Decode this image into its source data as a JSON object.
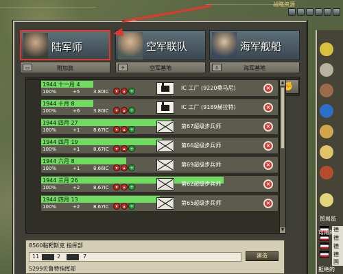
{
  "header": {
    "strategic_resources_label": "战略资源"
  },
  "tabs": [
    {
      "label": "陆军师",
      "active": true,
      "sub_label": "附加旅"
    },
    {
      "label": "空军联队",
      "active": false,
      "sub_label": "空军基地"
    },
    {
      "label": "海军舰船",
      "active": false,
      "sub_label": "海军基地"
    }
  ],
  "filters": [
    {
      "icon": "factory-icon"
    },
    {
      "icon": "artillery-icon"
    },
    {
      "icon": "radar-icon"
    },
    {
      "icon": "radiation-icon"
    },
    {
      "icon": "rocket-icon"
    },
    {
      "icon": "carrier-icon"
    },
    {
      "icon": "ship-icon"
    },
    {
      "icon": "fist-icon"
    }
  ],
  "queue": [
    {
      "date": "1944 十一月 4",
      "progress": 0.22,
      "pct": "100%",
      "plus": "+5",
      "ic": "3.80IC",
      "type": "factory",
      "name": "IC 工厂 (9220桑马尼)"
    },
    {
      "date": "1944 十月 8",
      "progress": 0.22,
      "pct": "100%",
      "plus": "+6",
      "ic": "3.80IC",
      "type": "factory",
      "name": "IC 工厂 (9189赫拉特)"
    },
    {
      "date": "1944 四月 27",
      "progress": 0.55,
      "pct": "100%",
      "plus": "+1",
      "ic": "8.67IC",
      "type": "infantry",
      "name": "第67超级步兵师"
    },
    {
      "date": "1944 四月 19",
      "progress": 0.51,
      "pct": "100%",
      "plus": "+1",
      "ic": "8.67IC",
      "type": "infantry",
      "name": "第66超级步兵师"
    },
    {
      "date": "1944 六月 8",
      "progress": 0.36,
      "pct": "100%",
      "plus": "+1",
      "ic": "8.66IC",
      "type": "infantry",
      "name": "第69超级步兵师"
    },
    {
      "date": "1944 三月 26",
      "progress": 0.77,
      "pct": "100%",
      "plus": "+2",
      "ic": "8.67IC",
      "type": "infantry",
      "name": "第62超级步兵师"
    },
    {
      "date": "1944 四月 13",
      "progress": 0.5,
      "pct": "100%",
      "plus": "+2",
      "ic": "8.67IC",
      "type": "infantry",
      "name": "第65超级步兵师"
    }
  ],
  "deploy": {
    "row1": "8560黏靶斯克 指挥部",
    "counts": [
      "11",
      "2",
      "7"
    ],
    "button": "建造",
    "row2": "5299贝鲁特指挥部"
  },
  "right": {
    "trade_label": "贸易监",
    "flags": [
      "德国",
      "德国",
      "德国",
      "德国"
    ],
    "bottom1": "可用的",
    "bottom2": "拒绝的"
  }
}
